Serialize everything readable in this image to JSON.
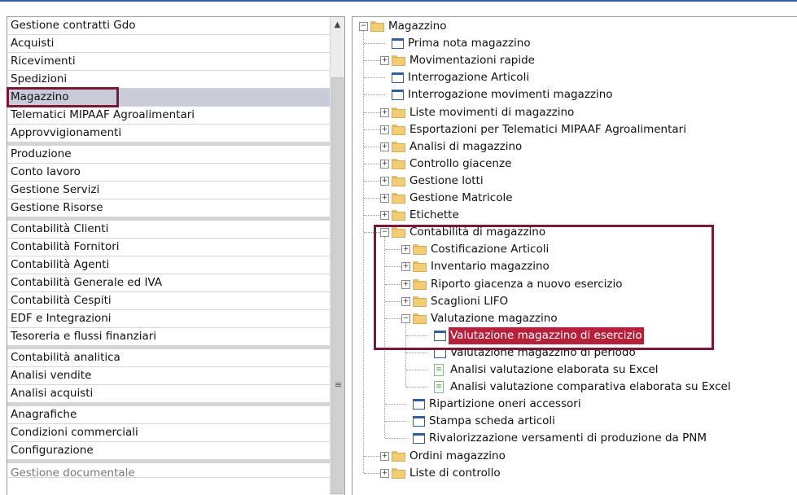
{
  "left_menu": {
    "groups": [
      [
        "Gestione contratti Gdo",
        "Acquisti",
        "Ricevimenti",
        "Spedizioni",
        "Magazzino",
        "Telematici MIPAAF Agroalimentari",
        "Approvvigionamenti"
      ],
      [
        "Produzione",
        "Conto lavoro",
        "Gestione Servizi",
        "Gestione Risorse"
      ],
      [
        "Contabilità Clienti",
        "Contabilità Fornitori",
        "Contabilità Agenti",
        "Contabilità Generale ed IVA",
        "Contabilità Cespiti",
        "EDF e Integrazioni",
        "Tesoreria e flussi finanziari"
      ],
      [
        "Contabilità analitica",
        "Analisi vendite",
        "Analisi acquisti"
      ],
      [
        "Anagrafiche",
        "Condizioni commerciali",
        "Configurazione"
      ],
      [
        "Gestione documentale"
      ]
    ],
    "selected": "Magazzino"
  },
  "tree": {
    "root": "Magazzino",
    "items": [
      {
        "label": "Prima nota magazzino",
        "icon": "window-icon",
        "level": 1,
        "expander": false
      },
      {
        "label": "Movimentazioni rapide",
        "icon": "folder-icon",
        "level": 1,
        "expander": true
      },
      {
        "label": "Interrogazione Articoli",
        "icon": "window-icon",
        "level": 1,
        "expander": false
      },
      {
        "label": "Interrogazione movimenti magazzino",
        "icon": "window-icon",
        "level": 1,
        "expander": false
      },
      {
        "label": "Liste movimenti di magazzino",
        "icon": "folder-icon",
        "level": 1,
        "expander": true
      },
      {
        "label": "Esportazioni per Telematici MIPAAF Agroalimentari",
        "icon": "folder-icon",
        "level": 1,
        "expander": true
      },
      {
        "label": "Analisi di magazzino",
        "icon": "folder-icon",
        "level": 1,
        "expander": true
      },
      {
        "label": "Controllo giacenze",
        "icon": "folder-icon",
        "level": 1,
        "expander": true
      },
      {
        "label": "Gestione lotti",
        "icon": "folder-icon",
        "level": 1,
        "expander": true
      },
      {
        "label": "Gestione Matricole",
        "icon": "folder-icon",
        "level": 1,
        "expander": true
      },
      {
        "label": "Etichette",
        "icon": "folder-icon",
        "level": 1,
        "expander": true
      },
      {
        "label": "Contabilità di magazzino",
        "icon": "folder-icon",
        "level": 1,
        "expander": true,
        "expanded": true
      },
      {
        "label": "Costificazione Articoli",
        "icon": "folder-icon",
        "level": 2,
        "expander": true
      },
      {
        "label": "Inventario magazzino",
        "icon": "folder-icon",
        "level": 2,
        "expander": true
      },
      {
        "label": "Riporto giacenza a nuovo esercizio",
        "icon": "folder-icon",
        "level": 2,
        "expander": true
      },
      {
        "label": "Scaglioni LIFO",
        "icon": "folder-icon",
        "level": 2,
        "expander": true
      },
      {
        "label": "Valutazione magazzino",
        "icon": "folder-icon",
        "level": 2,
        "expander": true,
        "expanded": true
      },
      {
        "label": "Valutazione magazzino di esercizio",
        "icon": "window-icon",
        "level": 3,
        "expander": false,
        "selected": true
      },
      {
        "label": "Valutazione magazzino di periodo",
        "icon": "window-icon",
        "level": 3,
        "expander": false
      },
      {
        "label": "Analisi valutazione elaborata su Excel",
        "icon": "excel-icon",
        "level": 3,
        "expander": false
      },
      {
        "label": "Analisi valutazione comparativa elaborata su Excel",
        "icon": "excel-icon",
        "level": 3,
        "expander": false
      },
      {
        "label": "Ripartizione oneri accessori",
        "icon": "window-icon",
        "level": 2,
        "expander": false
      },
      {
        "label": "Stampa scheda articoli",
        "icon": "window-icon",
        "level": 2,
        "expander": false
      },
      {
        "label": "Rivalorizzazione versamenti di produzione da PNM",
        "icon": "window-icon",
        "level": 2,
        "expander": false
      },
      {
        "label": "Ordini magazzino",
        "icon": "folder-icon",
        "level": 1,
        "expander": true
      },
      {
        "label": "Liste di controllo",
        "icon": "folder-icon",
        "level": 1,
        "expander": true
      }
    ]
  },
  "scrollbar": {
    "up_arrow": "^",
    "grip": "≡"
  }
}
